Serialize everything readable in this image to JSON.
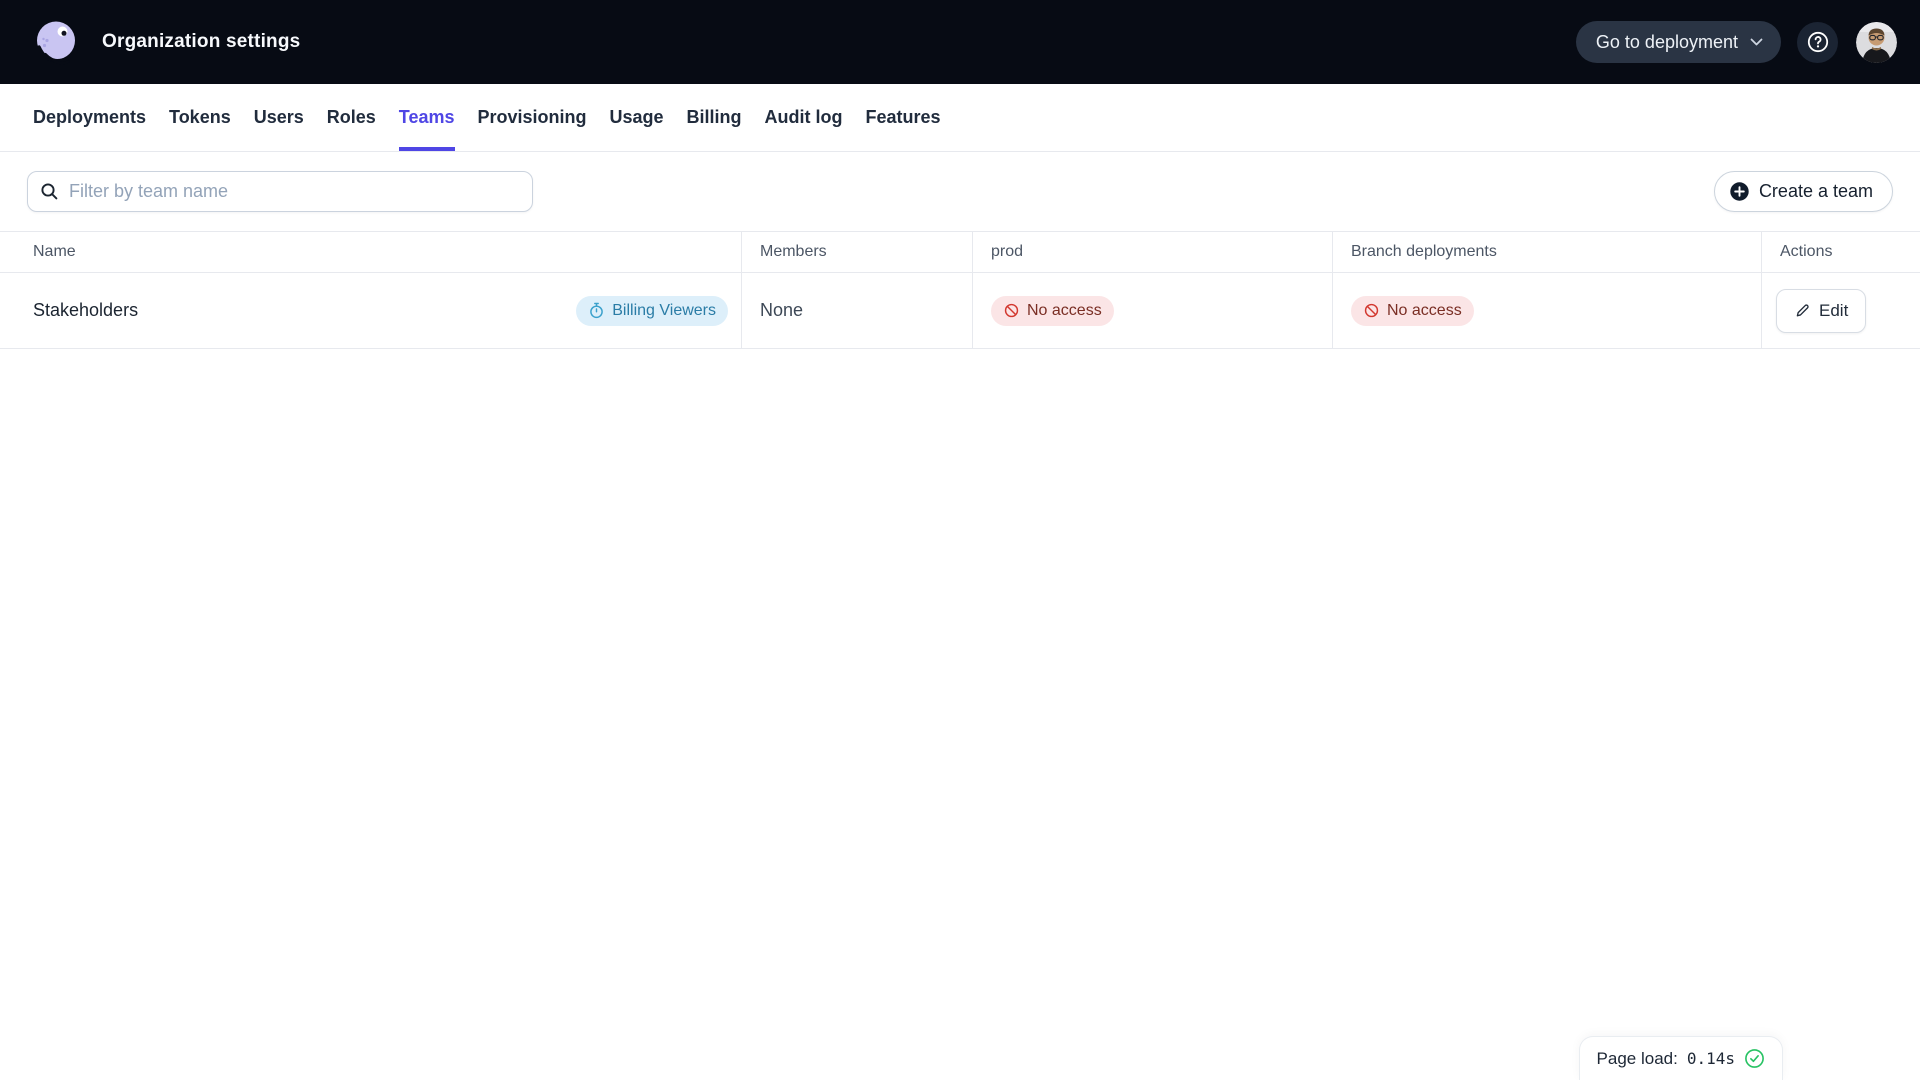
{
  "header": {
    "title": "Organization settings",
    "go_to_deployment": "Go to deployment"
  },
  "tabs": [
    {
      "label": "Deployments"
    },
    {
      "label": "Tokens"
    },
    {
      "label": "Users"
    },
    {
      "label": "Roles"
    },
    {
      "label": "Teams",
      "active": true
    },
    {
      "label": "Provisioning"
    },
    {
      "label": "Usage"
    },
    {
      "label": "Billing"
    },
    {
      "label": "Audit log"
    },
    {
      "label": "Features"
    }
  ],
  "toolbar": {
    "filter_placeholder": "Filter by team name",
    "filter_value": "",
    "create_team": "Create a team"
  },
  "table": {
    "columns": [
      "Name",
      "Members",
      "prod",
      "Branch deployments",
      "Actions"
    ],
    "rows": [
      {
        "name": "Stakeholders",
        "name_badge": "Billing Viewers",
        "members": "None",
        "prod_access": "No access",
        "branch_access": "No access",
        "edit_label": "Edit"
      }
    ]
  },
  "status_bar": {
    "page_load_label": "Page load:",
    "page_load_value": "0.14s"
  },
  "icons": {
    "logo": "octopus-logo",
    "help": "question-mark-circle-icon",
    "dropdown": "chevron-down-icon",
    "search": "magnifier-icon",
    "create": "plus-circle-icon",
    "team_badge": "stopwatch-icon",
    "no_access": "prohibited-circle-icon",
    "edit": "pencil-icon",
    "page_load_ok": "check-circle-icon"
  },
  "colors": {
    "accent": "#4f46e5",
    "header_bg": "#070b14",
    "badge_info_bg": "#ddeffa",
    "badge_info_text": "#2a7ca6",
    "badge_danger_bg": "#fbe5e6",
    "badge_danger_text": "#7a2e24",
    "danger_icon": "#d2372e",
    "success_icon": "#27c263"
  }
}
